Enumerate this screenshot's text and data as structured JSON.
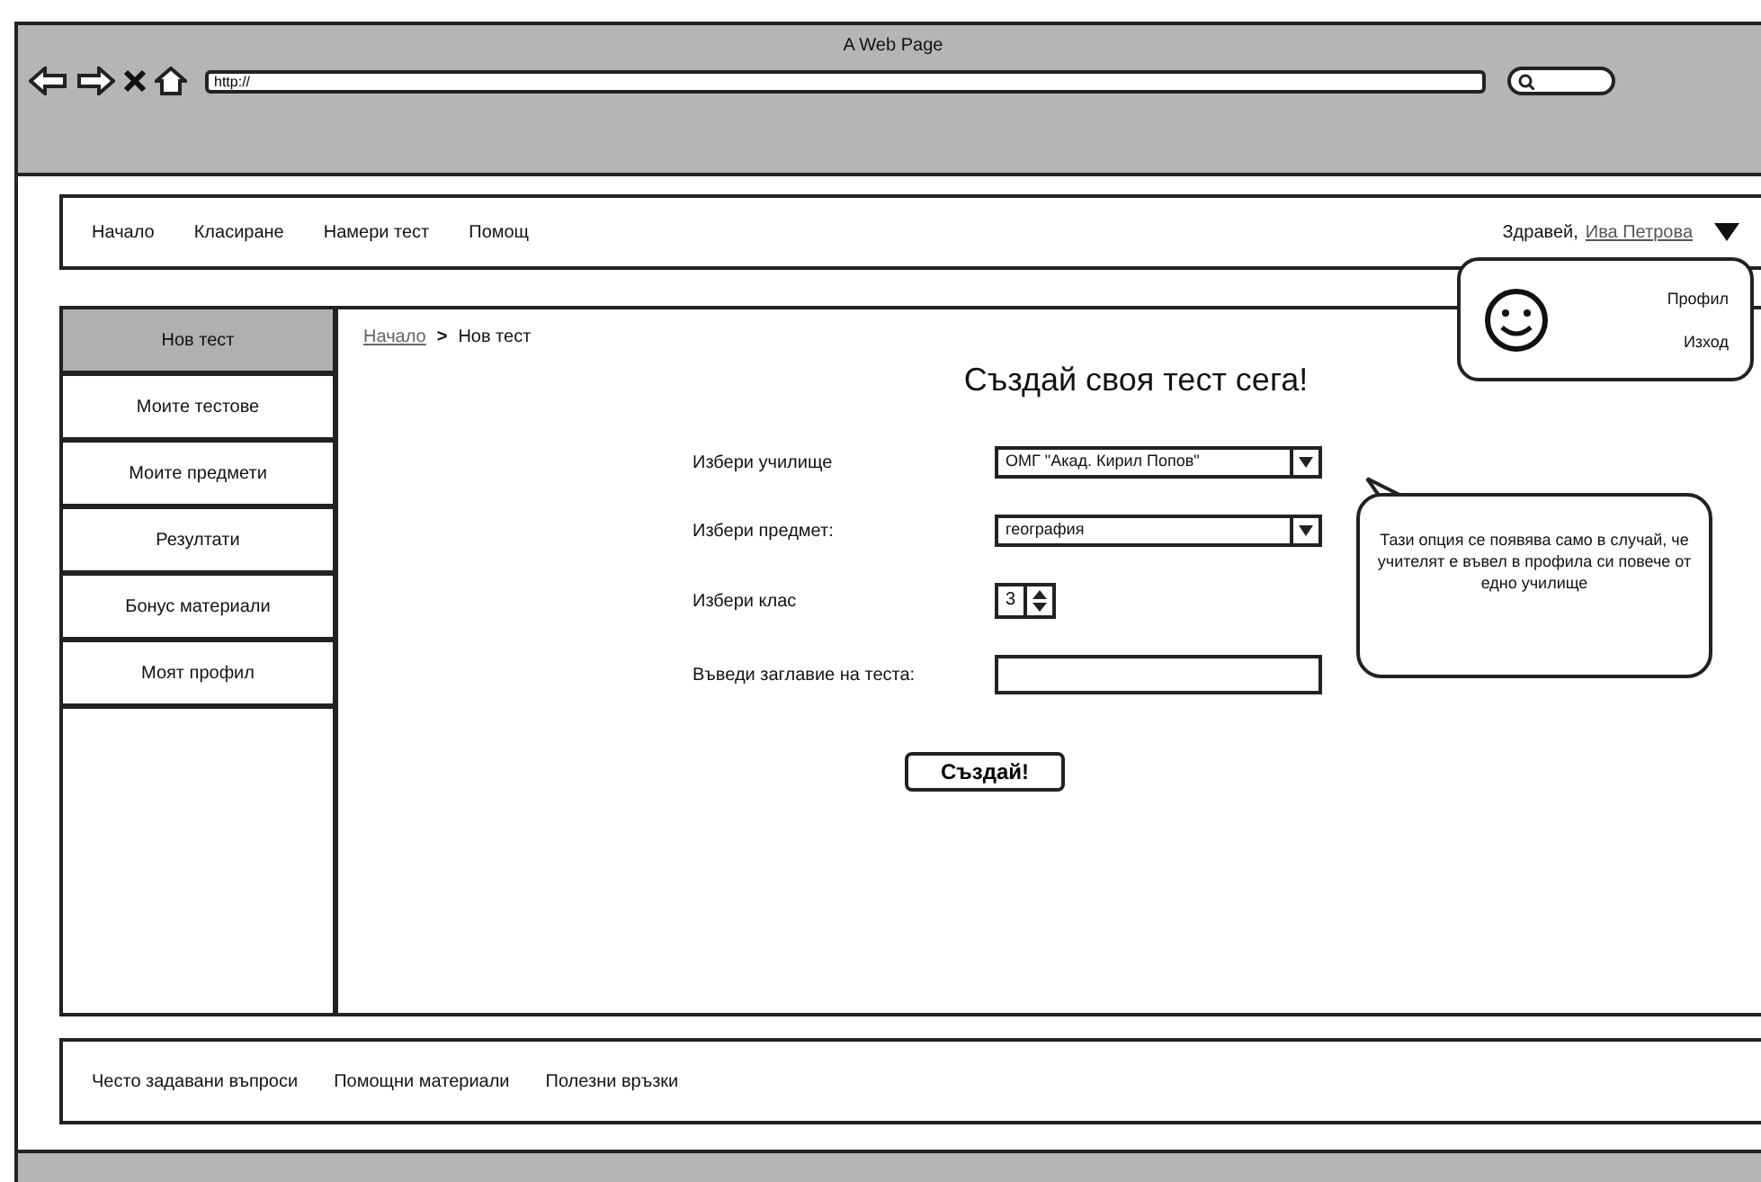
{
  "window": {
    "title": "A Web Page"
  },
  "address_bar": {
    "value": "http://"
  },
  "nav": {
    "items": [
      "Начало",
      "Класиране",
      "Намери тест",
      "Помощ"
    ],
    "greeting": "Здравей,",
    "user": "Ива Петрова"
  },
  "user_menu": {
    "items": [
      "Профил",
      "Изход"
    ]
  },
  "sidebar": {
    "items": [
      {
        "label": "Нов тест",
        "selected": true
      },
      {
        "label": "Моите тестове",
        "selected": false
      },
      {
        "label": "Моите предмети",
        "selected": false
      },
      {
        "label": "Резултати",
        "selected": false
      },
      {
        "label": "Бонус материали",
        "selected": false
      },
      {
        "label": "Моят профил",
        "selected": false
      }
    ]
  },
  "breadcrumb": {
    "link": "Начало",
    "separator": ">",
    "current": "Нов тест"
  },
  "heading": "Създай своя тест сега!",
  "form": {
    "fields": [
      {
        "kind": "select",
        "label": "Избери училище",
        "value": "ОМГ \"Акад. Кирил Попов\""
      },
      {
        "kind": "select",
        "label": "Избери предмет:",
        "value": "география"
      },
      {
        "kind": "spinner",
        "label": "Избери клас",
        "value": "3"
      },
      {
        "kind": "text",
        "label": "Въведи заглавие на теста:"
      }
    ],
    "submit": "Създай!"
  },
  "tooltip": "Тази опция се появява само в случай, че учителят е въвел в профила си повече от едно училище",
  "footer": {
    "links": [
      "Често задавани въпроси",
      "Помощни материали",
      "Полезни връзки"
    ]
  }
}
